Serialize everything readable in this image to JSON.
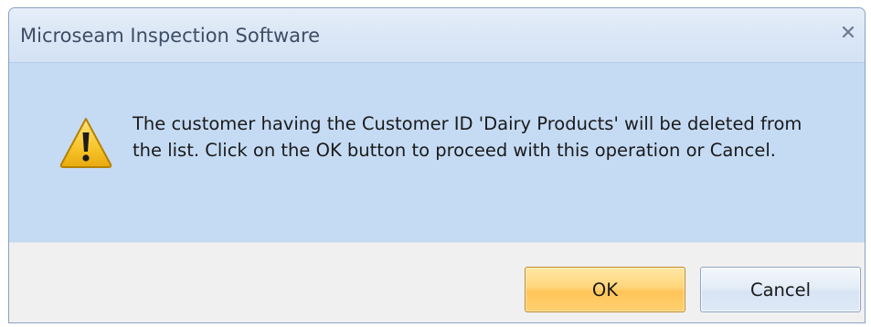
{
  "window": {
    "title": "Microseam Inspection Software",
    "close_icon": "close-icon"
  },
  "message": {
    "icon": "warning-icon",
    "text": "The customer having the Customer ID 'Dairy Products' will be deleted from the list. Click on the OK button to proceed with this operation or Cancel."
  },
  "buttons": {
    "ok_label": "OK",
    "cancel_label": "Cancel"
  },
  "colors": {
    "title_bar": "#dbe7f6",
    "content_background": "#c5dbf4",
    "footer_background": "#f0f0f0",
    "ok_button": "#ffd57a",
    "cancel_button": "#e4edf8"
  }
}
